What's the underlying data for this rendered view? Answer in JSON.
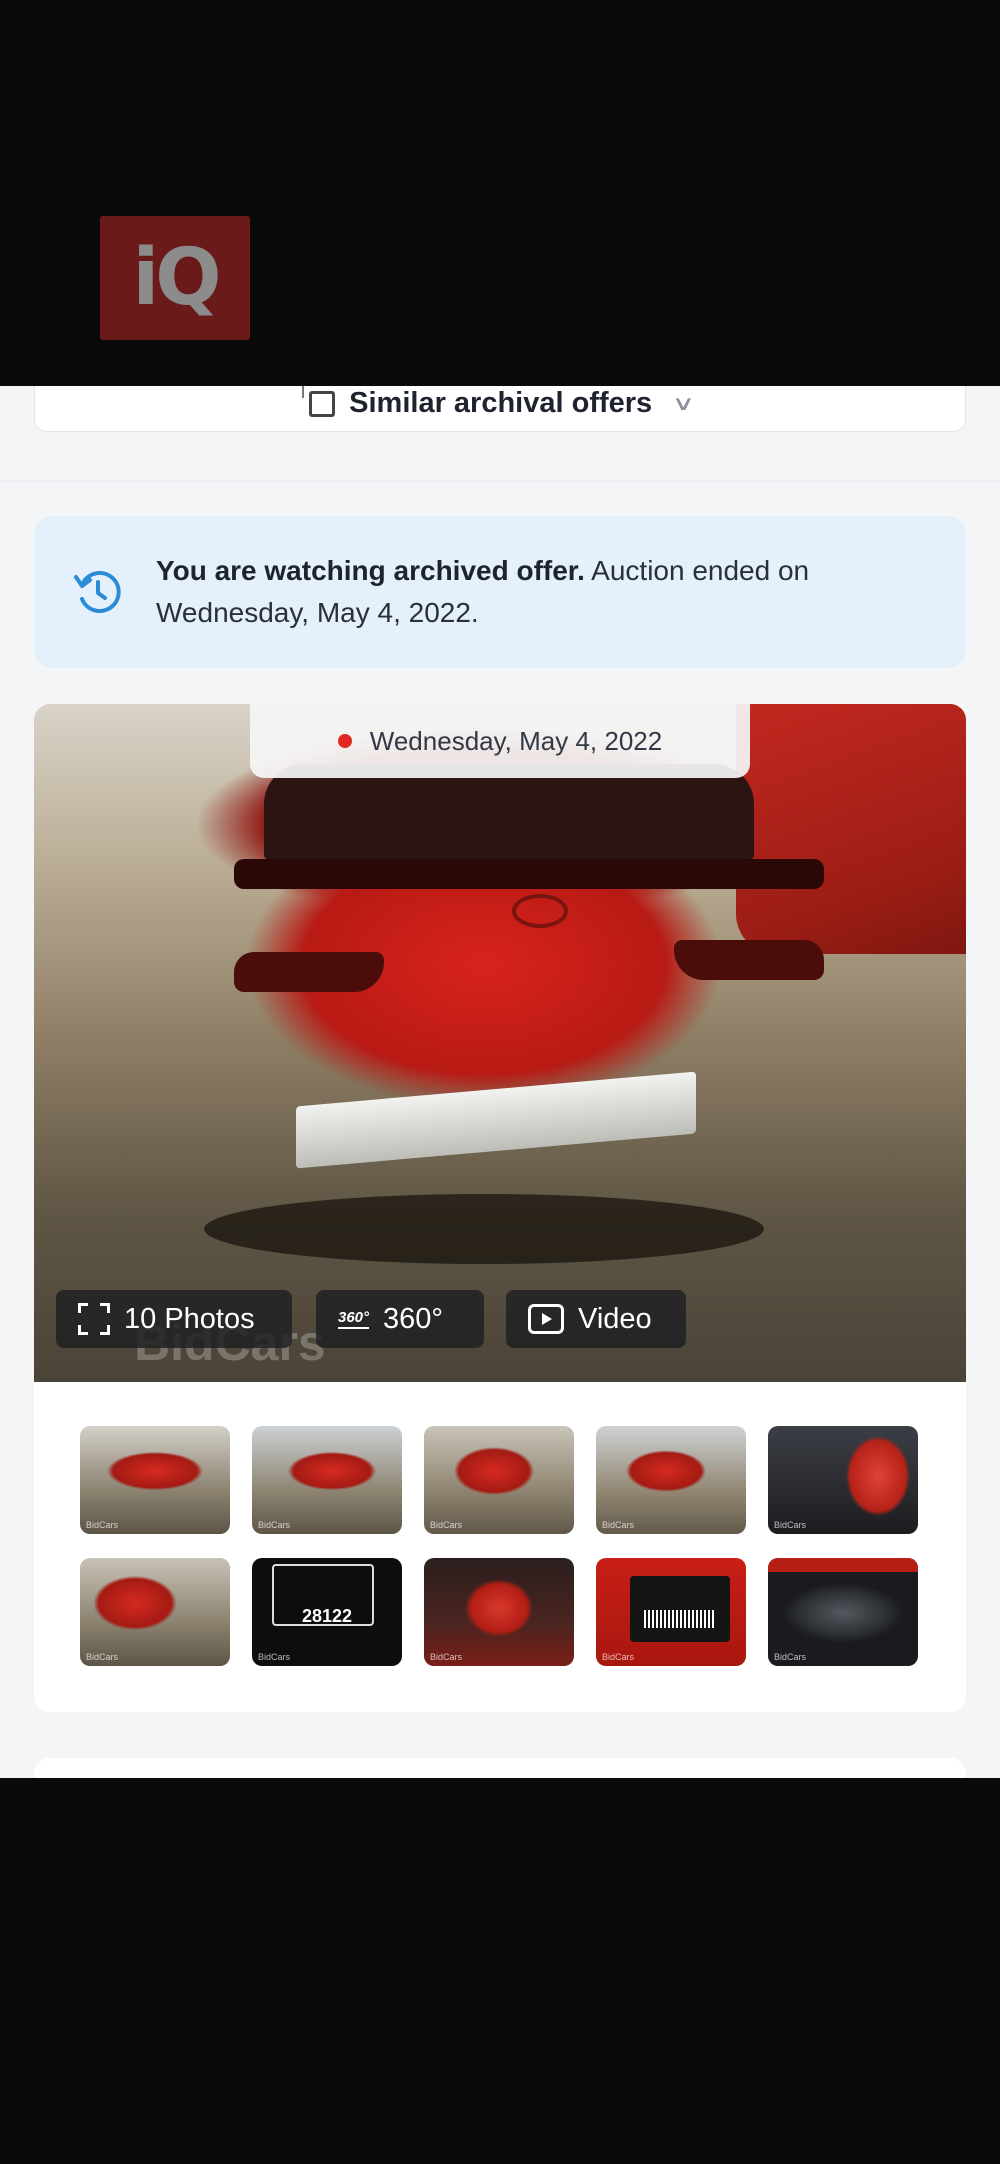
{
  "logo": {
    "text": "iQ"
  },
  "similar": {
    "label": "Similar archival offers"
  },
  "notice": {
    "bold": "You are watching archived offer.",
    "rest": " Auction ended on Wednesday, May 4, 2022."
  },
  "gallery": {
    "date": "Wednesday, May 4, 2022",
    "watermark": "BidCars",
    "buttons": {
      "photos": "10 Photos",
      "deg360_icon": "360°",
      "deg360": "360°",
      "video": "Video"
    },
    "thumb_watermark": "BidCars",
    "odometer": "28122"
  },
  "colors": {
    "accent_blue": "#2a8bd6",
    "notice_bg": "#e4f0fc",
    "dot_red": "#e02a1f"
  },
  "icons": [
    "iq-logo-icon",
    "checkbox-icon",
    "chevron-down-icon",
    "history-icon",
    "fullscreen-icon",
    "360-icon",
    "video-play-icon"
  ]
}
